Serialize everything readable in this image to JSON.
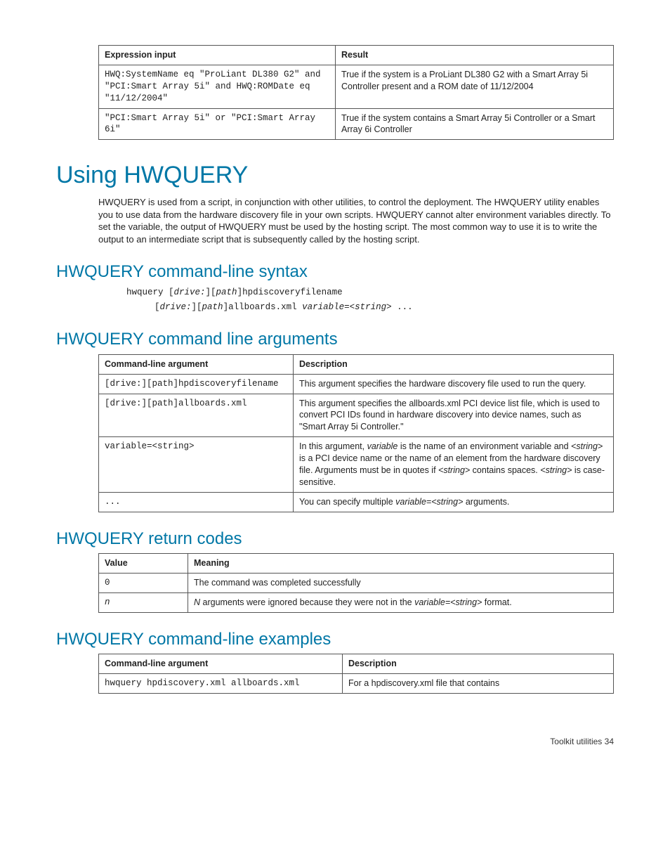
{
  "table_expr": {
    "headers": [
      "Expression input",
      "Result"
    ],
    "rows": [
      {
        "input": "HWQ:SystemName eq \"ProLiant DL380 G2\" and \"PCI:Smart Array 5i\" and HWQ:ROMDate eq \"11/12/2004\"",
        "result": "True if the system is a ProLiant DL380 G2 with a Smart Array 5i Controller present and a ROM date of 11/12/2004"
      },
      {
        "input": "\"PCI:Smart Array 5i\" or \"PCI:Smart Array 6i\"",
        "result": "True if the system contains a Smart Array 5i Controller or a Smart Array 6i Controller"
      }
    ]
  },
  "h1_using": "Using HWQUERY",
  "intro": "HWQUERY is used from a script, in conjunction with other utilities, to control the deployment. The HWQUERY utility enables you to use data from the hardware discovery file in your own scripts. HWQUERY cannot alter environment variables directly. To set the variable, the output of HWQUERY must be used by the hosting script. The most common way to use it is to write the output to an intermediate script that is subsequently called by the hosting script.",
  "h2_syntax": "HWQUERY command-line syntax",
  "syntax": {
    "l1a": "hwquery [",
    "l1b": "drive:",
    "l1c": "][",
    "l1d": "path",
    "l1e": "]hpdiscoveryfilename",
    "l2a": "[",
    "l2b": "drive:",
    "l2c": "][",
    "l2d": "path",
    "l2e": "]allboards.xml ",
    "l2f": "variable",
    "l2g": "=<",
    "l2h": "string",
    "l2i": "> ..."
  },
  "h2_args": "HWQUERY command line arguments",
  "table_args": {
    "headers": [
      "Command-line argument",
      "Description"
    ],
    "rows": [
      {
        "arg": "[drive:][path]hpdiscoveryfilename",
        "desc": "This argument specifies the hardware discovery file used to run the query."
      },
      {
        "arg": "[drive:][path]allboards.xml",
        "desc": "This argument specifies the allboards.xml PCI device list file, which is used to convert PCI IDs found in hardware discovery into device names, such as \"Smart Array 5i Controller.\""
      },
      {
        "arg": "variable=<string>",
        "desc_a": "In this argument, ",
        "desc_b": "variable",
        "desc_c": " is the name of an environment variable and ",
        "desc_d": "<string>",
        "desc_e": " is a PCI device name or the name of an element from the hardware discovery file. Arguments must be in quotes if ",
        "desc_f": "<string>",
        "desc_g": " contains spaces. ",
        "desc_h": "<string>",
        "desc_i": " is case-sensitive."
      },
      {
        "arg": "...",
        "desc_a": "You can specify multiple ",
        "desc_b": "variable=<string>",
        "desc_c": " arguments."
      }
    ]
  },
  "h2_return": "HWQUERY return codes",
  "table_return": {
    "headers": [
      "Value",
      "Meaning"
    ],
    "rows": [
      {
        "val": "0",
        "mean": "The command was completed successfully"
      },
      {
        "val": "n",
        "mean_a": "N",
        "mean_b": " arguments were ignored because they were not in the ",
        "mean_c": "variable=<string>",
        "mean_d": " format."
      }
    ]
  },
  "h2_examples": "HWQUERY command-line examples",
  "table_ex": {
    "headers": [
      "Command-line argument",
      "Description"
    ],
    "rows": [
      {
        "arg": "hwquery hpdiscovery.xml allboards.xml",
        "desc": "For a hpdiscovery.xml file that contains"
      }
    ]
  },
  "footer": "Toolkit utilities   34"
}
